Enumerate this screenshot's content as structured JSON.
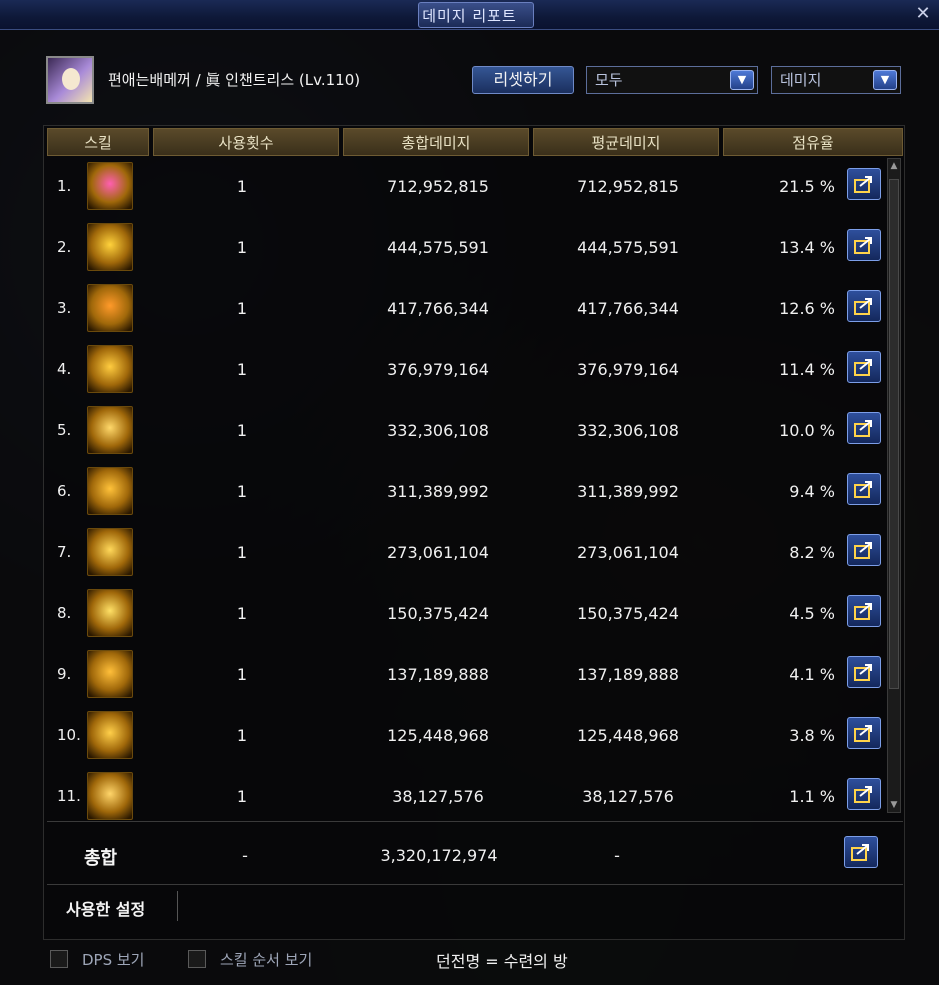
{
  "window": {
    "title": "데미지 리포트"
  },
  "header": {
    "character": "편애는배메꺼 / 眞 인챈트리스 (Lv.110)",
    "reset_button": "리셋하기",
    "filter_dropdown": "모두",
    "type_dropdown": "데미지"
  },
  "table": {
    "columns": [
      "스킬",
      "사용횟수",
      "총합데미지",
      "평균데미지",
      "점유율"
    ],
    "rows": [
      {
        "rank": "1.",
        "count": "1",
        "total": "712,952,815",
        "average": "712,952,815",
        "share": "21.5 %"
      },
      {
        "rank": "2.",
        "count": "1",
        "total": "444,575,591",
        "average": "444,575,591",
        "share": "13.4 %"
      },
      {
        "rank": "3.",
        "count": "1",
        "total": "417,766,344",
        "average": "417,766,344",
        "share": "12.6 %"
      },
      {
        "rank": "4.",
        "count": "1",
        "total": "376,979,164",
        "average": "376,979,164",
        "share": "11.4 %"
      },
      {
        "rank": "5.",
        "count": "1",
        "total": "332,306,108",
        "average": "332,306,108",
        "share": "10.0 %"
      },
      {
        "rank": "6.",
        "count": "1",
        "total": "311,389,992",
        "average": "311,389,992",
        "share": "9.4 %"
      },
      {
        "rank": "7.",
        "count": "1",
        "total": "273,061,104",
        "average": "273,061,104",
        "share": "8.2 %"
      },
      {
        "rank": "8.",
        "count": "1",
        "total": "150,375,424",
        "average": "150,375,424",
        "share": "4.5 %"
      },
      {
        "rank": "9.",
        "count": "1",
        "total": "137,189,888",
        "average": "137,189,888",
        "share": "4.1 %"
      },
      {
        "rank": "10.",
        "count": "1",
        "total": "125,448,968",
        "average": "125,448,968",
        "share": "3.8 %"
      },
      {
        "rank": "11.",
        "count": "1",
        "total": "38,127,576",
        "average": "38,127,576",
        "share": "1.1 %"
      }
    ],
    "total": {
      "label": "총합",
      "count": "-",
      "total": "3,320,172,974",
      "average": "-"
    },
    "used_settings": "사용한 설정"
  },
  "footer": {
    "dps_label": "DPS 보기",
    "skill_order_label": "스킬 순서 보기",
    "dungeon": "던전명 = 수련의 방"
  },
  "colors": {
    "header_gold": "#5a4a2a",
    "button_blue": "#2e4f9c"
  }
}
